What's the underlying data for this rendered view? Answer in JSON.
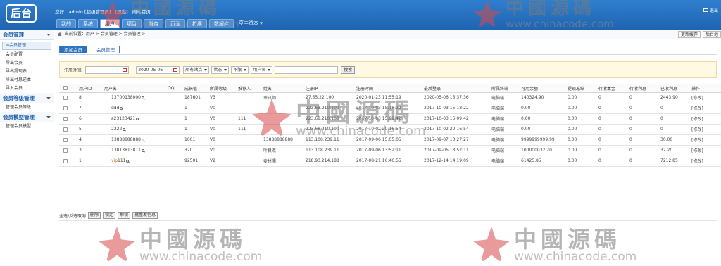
{
  "header": {
    "logo": "后台",
    "welcome": [
      "您好！admin [超级管理员]",
      "[退出]",
      "网站首页"
    ],
    "logout": "退出",
    "nav": [
      "我的",
      "系统",
      "用户",
      "项目",
      "财务",
      "页面",
      "扩展",
      "数据库",
      "亨丰资本"
    ],
    "active_nav": "用户"
  },
  "sidebar": {
    "groups": [
      {
        "title": "会员管理",
        "items": [
          "会员管理",
          "会员配置",
          "导出会员",
          "导出提现表",
          "导出付息还本",
          "导入会员"
        ]
      },
      {
        "title": "会员等级管理",
        "items": [
          "管理会员等级"
        ]
      },
      {
        "title": "会员模型管理",
        "items": [
          "管理会员模型"
        ]
      }
    ],
    "active_item": "会员管理"
  },
  "breadcrumb": {
    "text": "当前位置：用户 > 会员管理 > 会员管理 >",
    "buttons": [
      "更新缓存",
      "后台地"
    ]
  },
  "tabs": [
    "添加会员",
    "会员管理"
  ],
  "search": {
    "label": "注册时间:",
    "date_from": "",
    "dash": "-",
    "date_to": "2020-05-06",
    "site": "所有站点",
    "status": "状态",
    "limit": "不限",
    "field": "用户名",
    "keyword": "",
    "button": "搜索"
  },
  "table": {
    "columns": [
      "",
      "用户ID",
      "用户名",
      "QQ",
      "成长值",
      "所属等级",
      "推荐人",
      "姓名",
      "注册IP",
      "注册时间",
      "最后登录",
      "所属终端",
      "可用余额",
      "提现冻结",
      "待收本金",
      "待收利息",
      "已收利息",
      "操作"
    ],
    "rows": [
      [
        "8",
        "13700138000",
        "",
        "187601",
        "V3",
        "",
        "审讯师",
        "27.55.22.100",
        "2020-01-23 11:55:19",
        "2020-05-06 15:37:36",
        "电脑端",
        "140324.90",
        "0.00",
        "0",
        "0",
        "2443.90",
        "[修改]"
      ],
      [
        "7",
        "ddd",
        "",
        "1",
        "V0",
        "",
        "",
        "223.68.210.100",
        "2017-10-03 15:18:22",
        "2017-10-03 15:18:22",
        "电脑端",
        "0.00",
        "0.00",
        "0",
        "0",
        "0",
        "[修改]"
      ],
      [
        "6",
        "a23123421",
        "",
        "1",
        "V0",
        "111",
        "",
        "223.68.210.100",
        "2017-10-03 15:09:42",
        "2017-10-03 15:09:42",
        "电脑端",
        "0.00",
        "0.00",
        "0",
        "0",
        "0",
        "[修改]"
      ],
      [
        "5",
        "2222",
        "",
        "1",
        "V0",
        "111",
        "",
        "223.68.210.100",
        "2017-10-02 20:16:54",
        "2017-10-02 20:16:54",
        "电脑端",
        "0.00",
        "0.00",
        "0",
        "0",
        "0",
        "[修改]"
      ],
      [
        "4",
        "13888888888",
        "",
        "1001",
        "V0",
        "",
        "13888888888",
        "113.108.239.11",
        "2017-09-06 15:05:05",
        "2017-09-07 13:27:27",
        "电脑端",
        "9999999999.99",
        "0.00",
        "0",
        "0",
        "30.00",
        "[修改]"
      ],
      [
        "3",
        "13813813811",
        "",
        "3201",
        "V0",
        "",
        "叶良杰",
        "113.108.239.11",
        "2017-09-06 13:52:11",
        "2017-09-06 13:52:11",
        "电脑端",
        "100000032.20",
        "0.00",
        "0",
        "0",
        "32.20",
        "[修改]"
      ],
      [
        "1",
        "111",
        "",
        "92501",
        "V2",
        "",
        "麦材濡",
        "218.93.214.188",
        "2017-08-21 16:46:55",
        "2017-12-14 14:19:09",
        "电脑端",
        "61425.85",
        "0.00",
        "0",
        "0",
        "7212.85",
        "[修改]"
      ]
    ],
    "vip_badge": "vip"
  },
  "footer": {
    "select_text": "全选/反选取消",
    "buttons": [
      "删除",
      "锁定",
      "解锁",
      "批量发信息"
    ]
  },
  "watermark": {
    "cn": "中國源碼",
    "url": "www.chinacode.com"
  }
}
